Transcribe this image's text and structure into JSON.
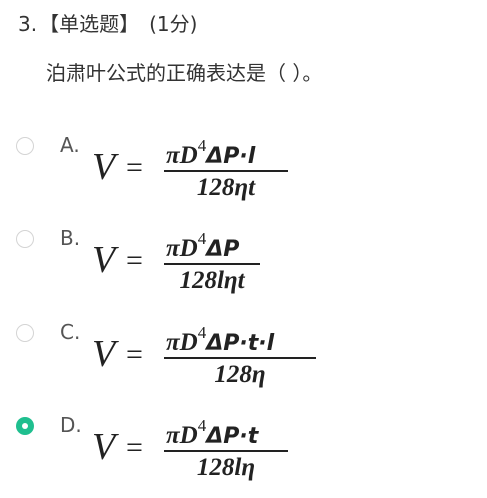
{
  "question": {
    "number": "3.",
    "type": "【单选题】",
    "score": "(1分)",
    "stem": "泊肃叶公式的正确表达是（ ）。"
  },
  "options": [
    {
      "letter": "A.",
      "lhs": "V",
      "equals": "=",
      "numerator": {
        "pre": "πD",
        "sup": "4",
        "post": "ΔP·l"
      },
      "denominator": "128ηt",
      "selected": false
    },
    {
      "letter": "B.",
      "lhs": "V",
      "equals": "=",
      "numerator": {
        "pre": "πD",
        "sup": "4",
        "post": "ΔP"
      },
      "denominator": "128lηt",
      "selected": false
    },
    {
      "letter": "C.",
      "lhs": "V",
      "equals": "=",
      "numerator": {
        "pre": "πD",
        "sup": "4",
        "post": "ΔP·t·l"
      },
      "denominator": "128η",
      "selected": false
    },
    {
      "letter": "D.",
      "lhs": "V",
      "equals": "=",
      "numerator": {
        "pre": "πD",
        "sup": "4",
        "post": "ΔP·t"
      },
      "denominator": "128lη",
      "selected": true
    }
  ],
  "colors": {
    "selected_radio": "#1fbf8f",
    "unselected_radio_border": "#d4d4d4",
    "text": "#333333"
  }
}
